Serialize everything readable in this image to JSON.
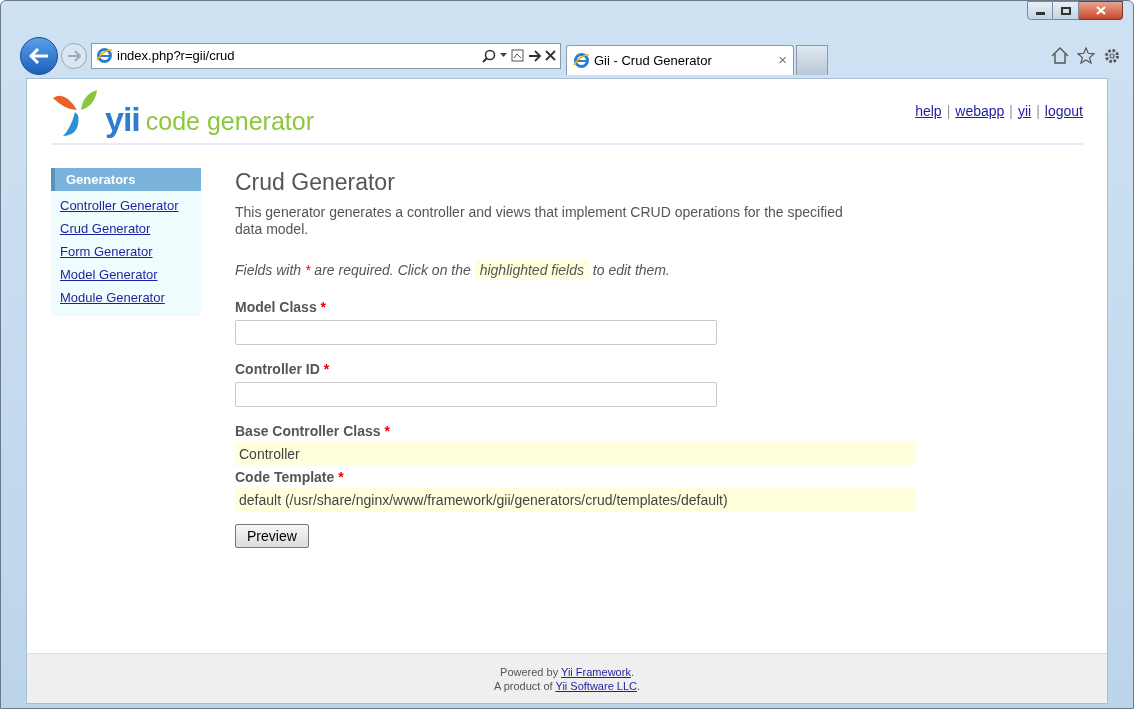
{
  "browser": {
    "address": "index.php?r=gii/crud",
    "tab_title": "Gii - Crud Generator",
    "tab_close": "×"
  },
  "header": {
    "logo_word": "yii",
    "logo_tagline": "code generator",
    "link_separator": "|",
    "links": [
      "help",
      "webapp",
      "yii",
      "logout"
    ]
  },
  "sidebar": {
    "title": "Generators",
    "items": [
      "Controller Generator",
      "Crud Generator",
      "Form Generator",
      "Model Generator",
      "Module Generator"
    ]
  },
  "main": {
    "title": "Crud Generator",
    "description": "This generator generates a controller and views that implement CRUD operations for the specified data model.",
    "note": {
      "before": "Fields with ",
      "mark": "*",
      "middle": " are required. Click on the ",
      "highlight": "highlighted fields",
      "after": " to edit them."
    },
    "required_mark": "*",
    "fields": [
      {
        "label": "Model Class",
        "required": true,
        "kind": "input"
      },
      {
        "label": "Controller ID",
        "required": true,
        "kind": "input"
      },
      {
        "label": "Base Controller Class",
        "required": true,
        "kind": "sticky",
        "value": "Controller"
      },
      {
        "label": "Code Template",
        "required": true,
        "kind": "sticky",
        "value": "default (/usr/share/nginx/www/framework/gii/generators/crud/templates/default)"
      }
    ],
    "button": "Preview"
  },
  "footer": {
    "line1": {
      "text": "Powered by ",
      "link": "Yii Framework",
      "end": "."
    },
    "line2": {
      "text": "A product of ",
      "link": "Yii Software LLC",
      "end": "."
    }
  }
}
